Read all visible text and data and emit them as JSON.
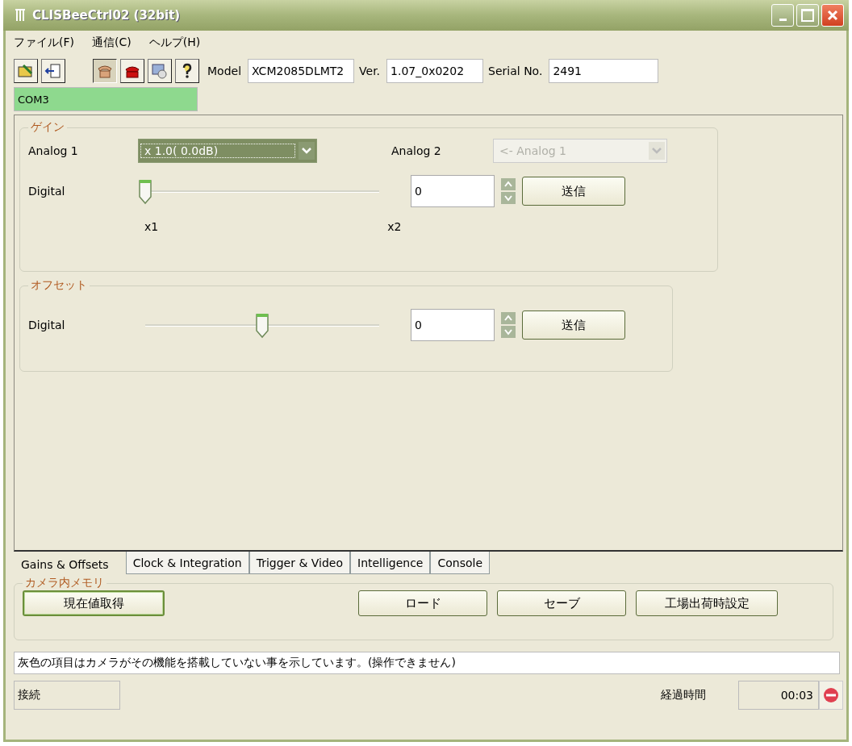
{
  "window": {
    "title": "CLISBeeCtrl02 (32bit)"
  },
  "menu": [
    {
      "label": "ファイル(F)"
    },
    {
      "label": "通信(C)"
    },
    {
      "label": "ヘルプ(H)"
    }
  ],
  "toolbar": [
    {
      "kind": "open",
      "pressed": false
    },
    {
      "kind": "export",
      "pressed": false
    },
    {
      "kind": "connect",
      "pressed": true
    },
    {
      "kind": "disconnect",
      "pressed": false
    },
    {
      "kind": "settings",
      "pressed": false
    },
    {
      "kind": "help",
      "pressed": false
    }
  ],
  "info": [
    {
      "label": "Model",
      "value": "XCM2085DLMT2"
    },
    {
      "label": "Ver.",
      "value": "1.07_0x0202"
    },
    {
      "label": "Serial No.",
      "value": "2491"
    }
  ],
  "port": "COM3",
  "gain": {
    "title": "ゲイン",
    "analog": [
      {
        "label": "Analog 1",
        "value": "x 1.0( 0.0dB)",
        "disabled": false
      },
      {
        "label": "Analog 2",
        "value": "<- Analog 1",
        "disabled": true
      }
    ],
    "digital": {
      "label": "Digital",
      "level": 0,
      "value": "0",
      "button": "送信"
    },
    "scale": [
      "x1",
      "x2"
    ]
  },
  "offset": {
    "title": "オフセット",
    "digital": {
      "label": "Digital",
      "level": 0.5,
      "value": "0",
      "button": "送信"
    }
  },
  "tabs": [
    {
      "label": "Gains & Offsets",
      "selected": true
    },
    {
      "label": "Clock & Integration",
      "selected": false
    },
    {
      "label": "Trigger & Video",
      "selected": false
    },
    {
      "label": "Intelligence",
      "selected": false
    },
    {
      "label": "Console",
      "selected": false
    }
  ],
  "memory": {
    "title": "カメラ内メモリ",
    "buttons": [
      {
        "label": "現在値取得",
        "default": true
      },
      {
        "label": "ロード",
        "default": false
      },
      {
        "label": "セーブ",
        "default": false
      },
      {
        "label": "工場出荷時設定",
        "default": false
      }
    ]
  },
  "message": "灰色の項目はカメラがその機能を搭載していない事を示しています。(操作できません)",
  "status": {
    "connection": "接続",
    "elapsed_label": "経過時間",
    "elapsed": "00:03"
  }
}
